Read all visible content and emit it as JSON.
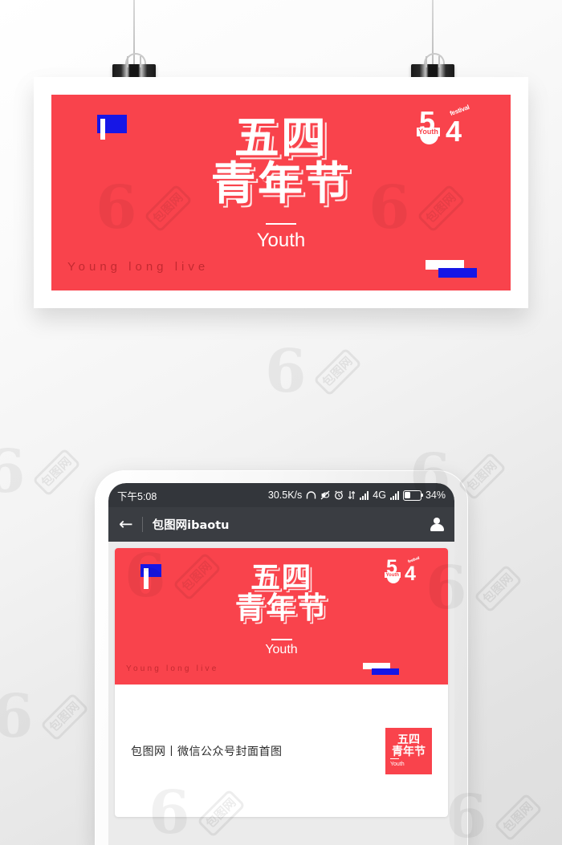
{
  "poster": {
    "background_color": "#f9434c",
    "flag_color": "#1616e6",
    "title_lines": [
      "五四",
      "青年节"
    ],
    "subtitle": "Youth",
    "tagline": "Young long live",
    "logo": {
      "five": "5",
      "four": "4",
      "youth_label": "Youth",
      "festival_label": "festival"
    }
  },
  "phone": {
    "status_bar": {
      "time": "下午5:08",
      "network_speed": "30.5K/s",
      "icons": [
        "headphone-icon",
        "mute-icon",
        "alarm-icon",
        "data-transfer-icon"
      ],
      "network_type": "4G",
      "battery_percent": "34%"
    },
    "app_bar": {
      "back_label": "←",
      "title": "包图网ibaotu",
      "account_icon": "person-icon"
    },
    "post": {
      "caption": "包图网丨微信公众号封面首图",
      "thumbnail": {
        "title_lines": [
          "五四",
          "青年节"
        ],
        "subtitle": "Youth"
      }
    }
  },
  "watermark": {
    "glyph": "6",
    "label": "包图网"
  },
  "decor": {
    "clip_count": 2
  }
}
